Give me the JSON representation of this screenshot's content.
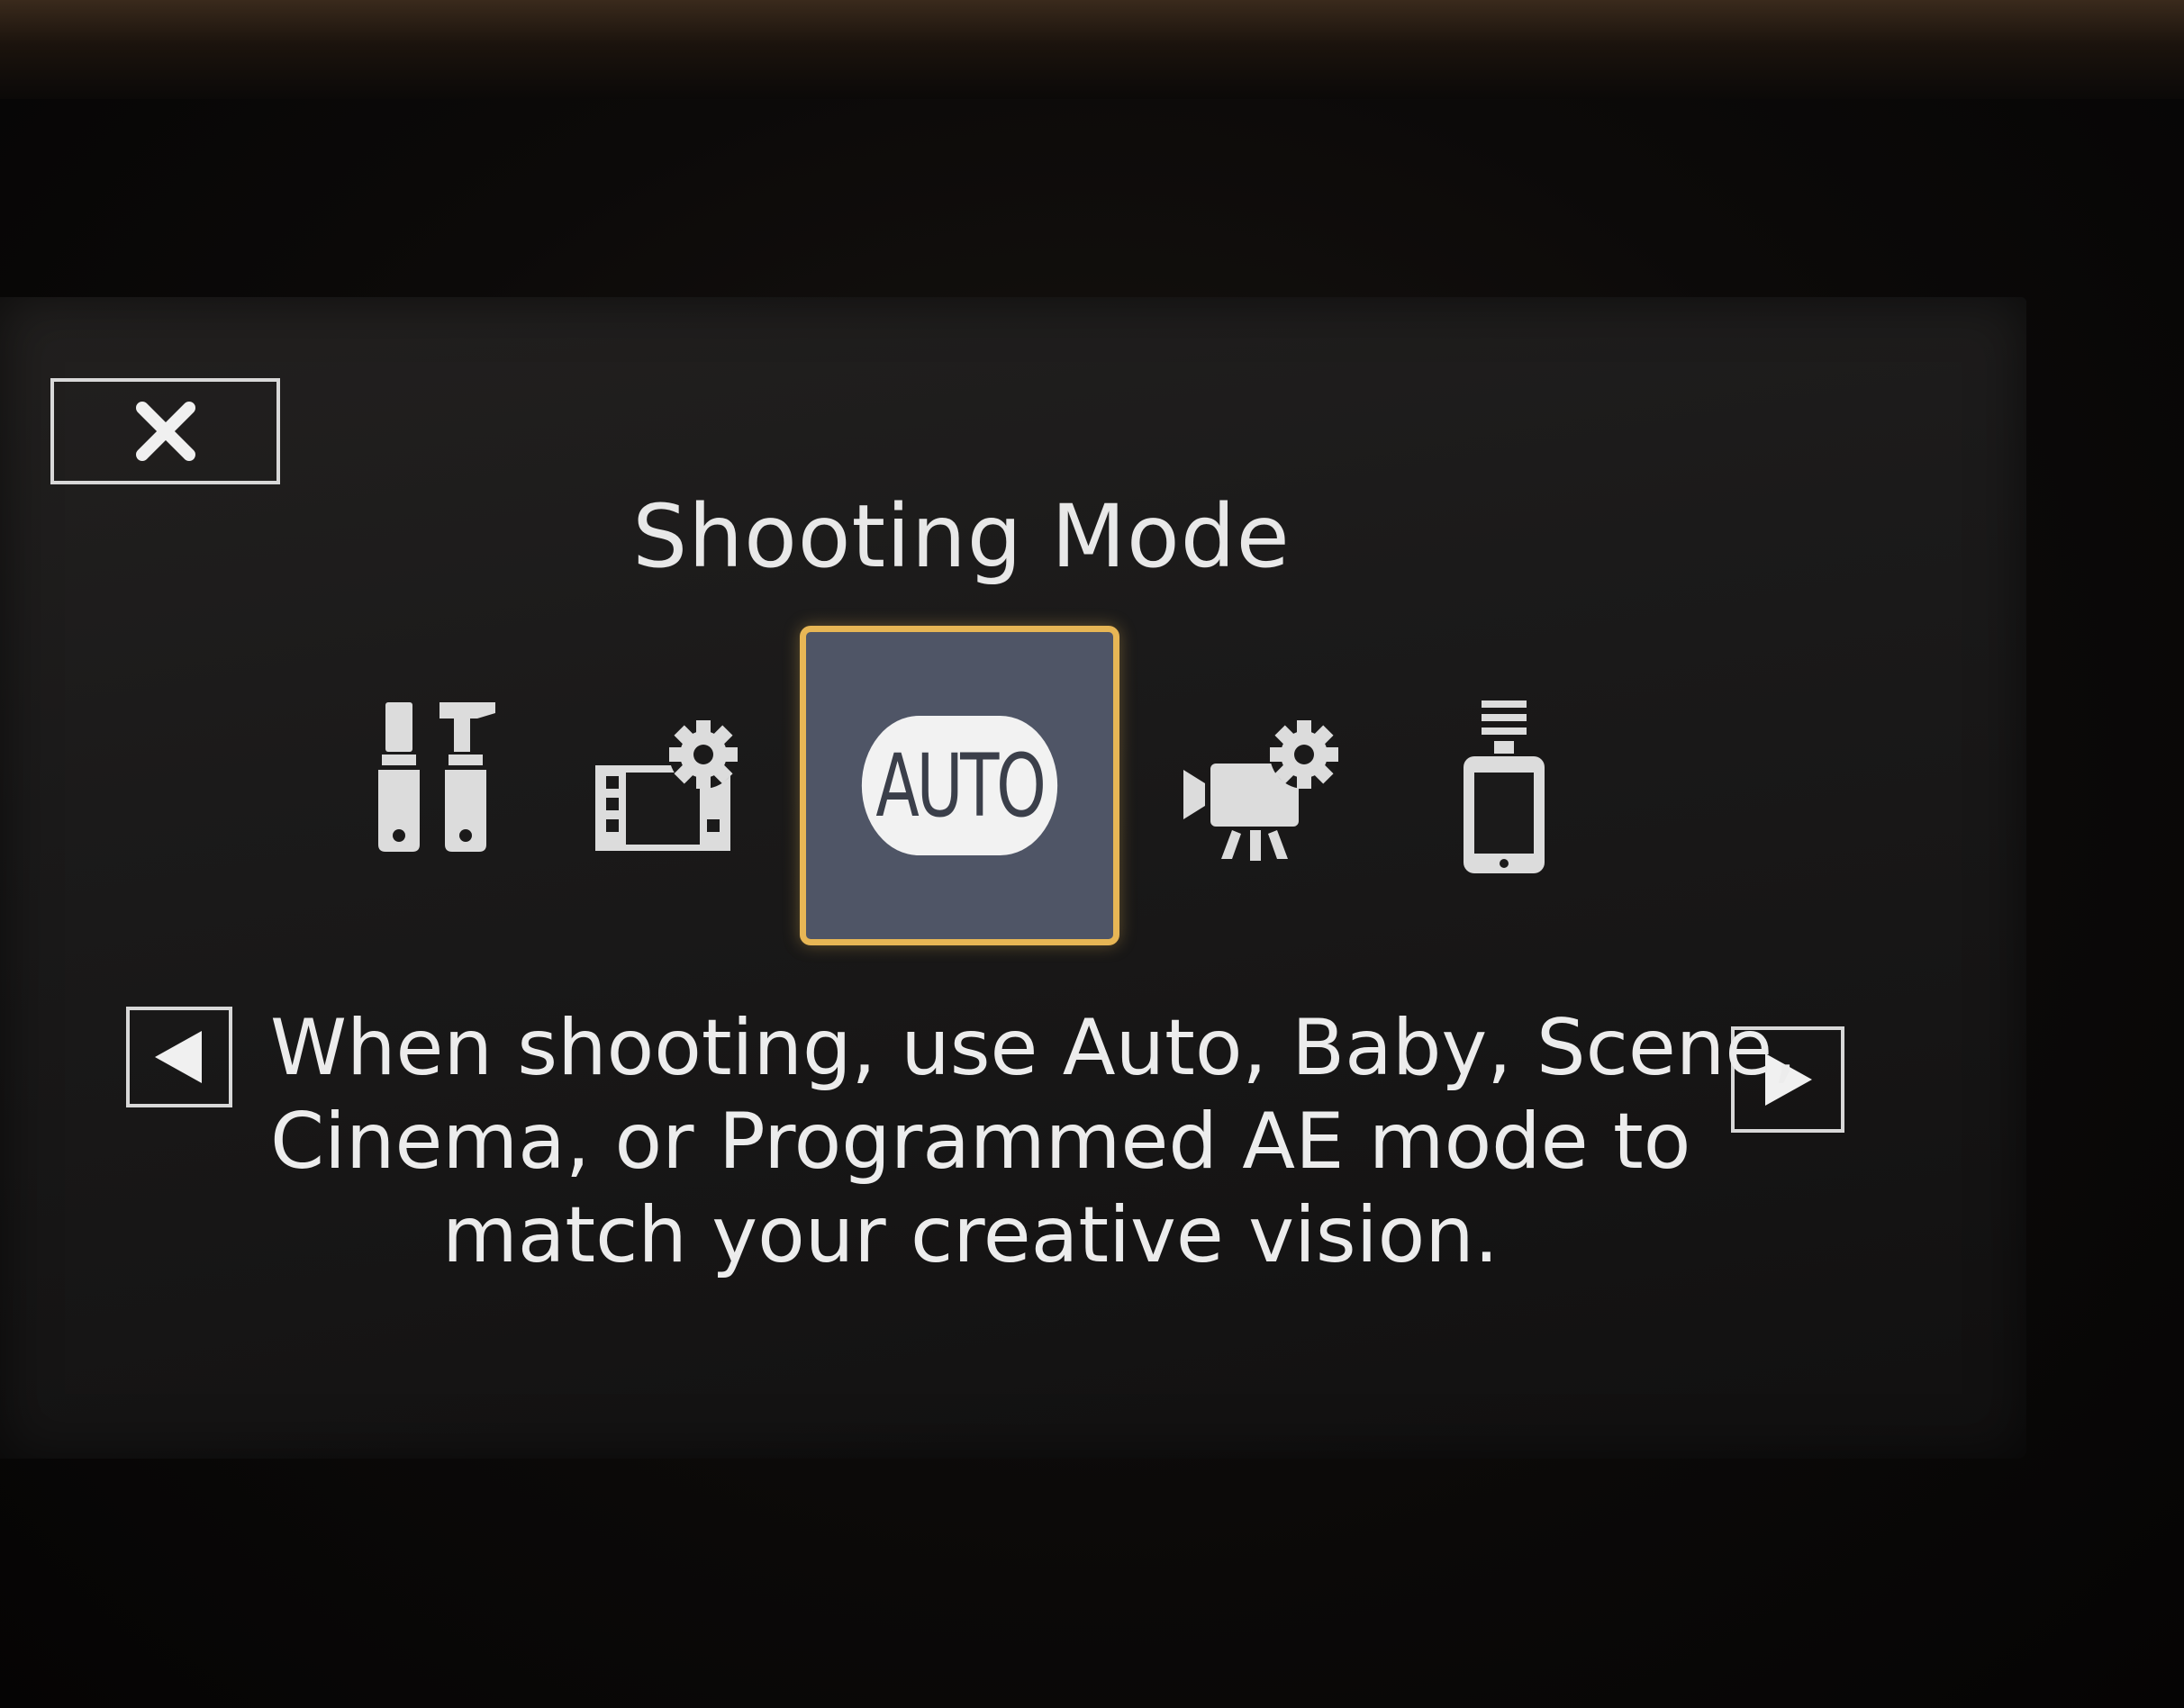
{
  "screen": {
    "title": "Shooting Mode",
    "close_icon": "close-x-icon",
    "modes": [
      {
        "id": "tools",
        "icon": "tools-icon",
        "selected": false
      },
      {
        "id": "movie-settings",
        "icon": "film-gear-icon",
        "selected": false
      },
      {
        "id": "auto",
        "label": "AUTO",
        "icon": "auto-pill-icon",
        "selected": true
      },
      {
        "id": "camcorder-settings",
        "icon": "camcorder-gear-icon",
        "selected": false
      },
      {
        "id": "smartphone",
        "icon": "smartphone-wifi-icon",
        "selected": false
      }
    ],
    "description_lines": [
      "When shooting, use Auto, Baby, Scene,",
      "Cinema, or Programmed AE mode to",
      "match your creative vision."
    ],
    "prev_icon": "left-arrow-icon",
    "next_icon": "right-arrow-icon"
  },
  "colors": {
    "selection_border": "#e7b655",
    "selection_fill": "#4f5566",
    "text": "#ececec",
    "screen_background": "#1b1a1a"
  }
}
